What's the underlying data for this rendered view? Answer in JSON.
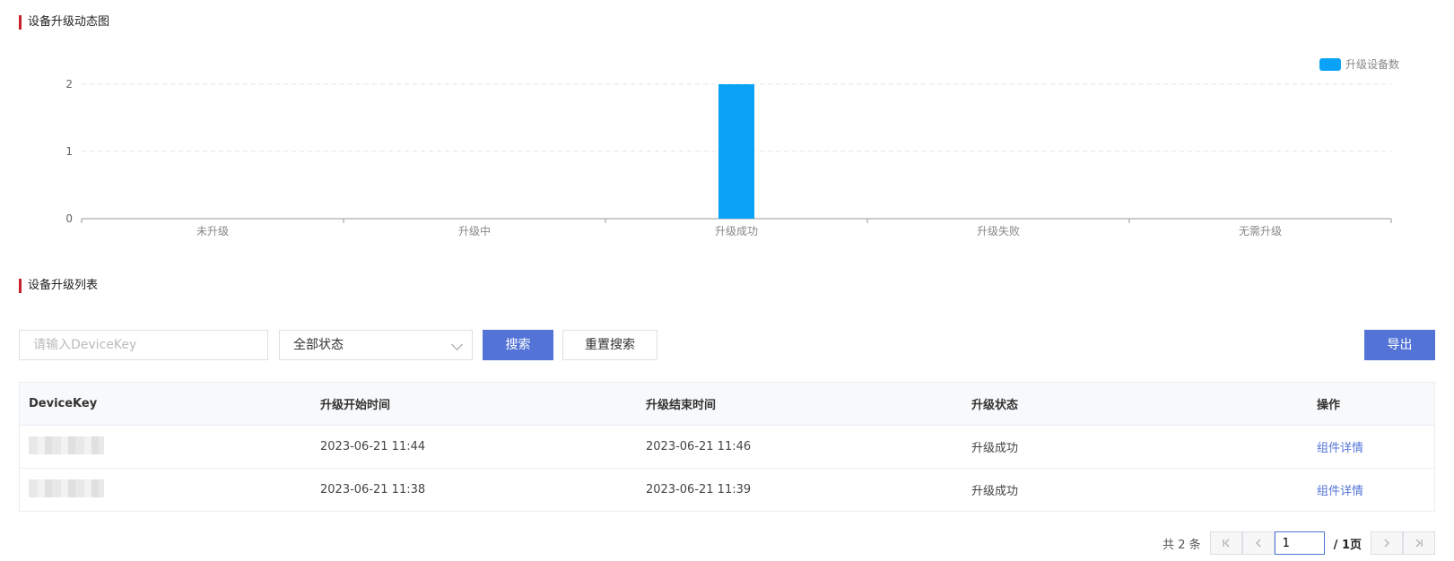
{
  "chart_section": {
    "title": "设备升级动态图"
  },
  "chart_data": {
    "type": "bar",
    "categories": [
      "未升级",
      "升级中",
      "升级成功",
      "升级失败",
      "无需升级"
    ],
    "series": [
      {
        "name": "升级设备数",
        "values": [
          0,
          0,
          2,
          0,
          0
        ]
      }
    ],
    "ylim": [
      0,
      2
    ],
    "yticks": [
      0,
      1,
      2
    ],
    "grid": true,
    "legend": "top-right",
    "color": "#0aa2f7"
  },
  "list_section": {
    "title": "设备升级列表"
  },
  "filters": {
    "devicekey_placeholder": "请输入DeviceKey",
    "status_value": "全部状态",
    "search_label": "搜索",
    "reset_label": "重置搜索",
    "export_label": "导出"
  },
  "table": {
    "headers": [
      "DeviceKey",
      "升级开始时间",
      "升级结束时间",
      "升级状态",
      "操作"
    ],
    "rows": [
      {
        "start": "2023-06-21 11:44",
        "end": "2023-06-21 11:46",
        "status": "升级成功",
        "action": "组件详情"
      },
      {
        "start": "2023-06-21 11:38",
        "end": "2023-06-21 11:39",
        "status": "升级成功",
        "action": "组件详情"
      }
    ]
  },
  "pagination": {
    "total_text": "共 2 条",
    "current_page": "1",
    "page_of_text": "/ 1页"
  },
  "icons": {
    "first": "first-page-icon",
    "prev": "prev-page-icon",
    "next": "next-page-icon",
    "last": "last-page-icon",
    "dropdown": "chevron-down-icon"
  }
}
